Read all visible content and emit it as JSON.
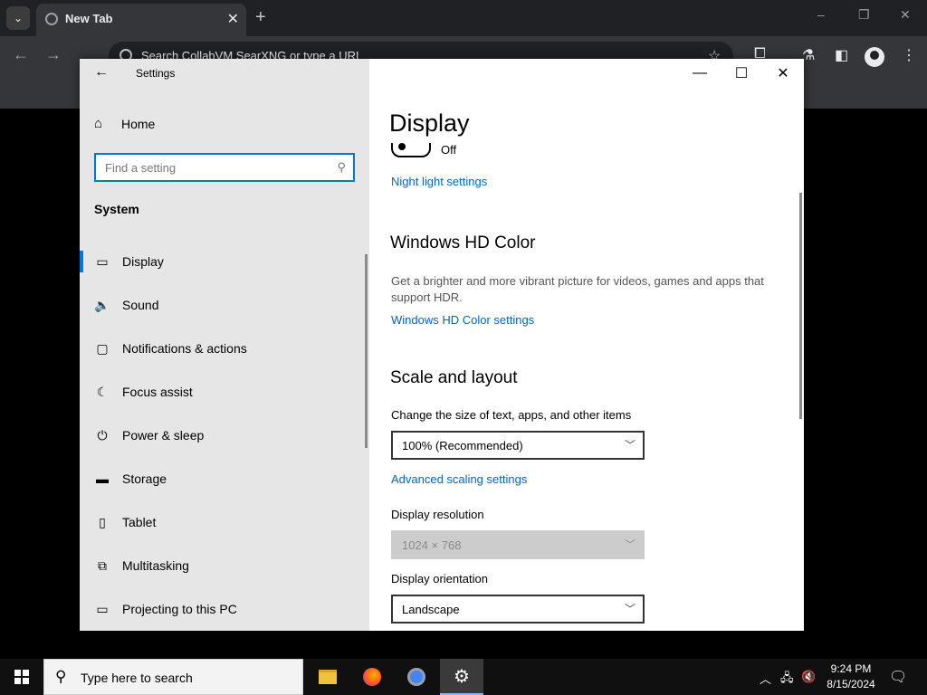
{
  "browser": {
    "tab_list_icon": "chevron-down-icon",
    "tab_title": "New Tab",
    "tab_close": "✕",
    "new_tab": "+",
    "minimize": "–",
    "restore": "❐",
    "close": "✕",
    "back": "←",
    "forward": "→",
    "omnibox_placeholder": "Search CollabVM SearXNG or type a URL",
    "icons": [
      "star-icon",
      "extensions-icon",
      "labs-icon",
      "sidebar-icon",
      "profile-icon",
      "menu-icon"
    ]
  },
  "settings": {
    "app_title": "Settings",
    "back_glyph": "←",
    "home_label": "Home",
    "search_placeholder": "Find a setting",
    "section_title": "System",
    "nav_items": [
      {
        "label": "Display",
        "icon": "monitor-icon",
        "glyph": "▭"
      },
      {
        "label": "Sound",
        "icon": "speaker-icon",
        "glyph": "🔈"
      },
      {
        "label": "Notifications & actions",
        "icon": "notification-icon",
        "glyph": "▢"
      },
      {
        "label": "Focus assist",
        "icon": "moon-icon",
        "glyph": "☾"
      },
      {
        "label": "Power & sleep",
        "icon": "power-icon",
        "glyph": "⏻"
      },
      {
        "label": "Storage",
        "icon": "storage-icon",
        "glyph": "▬"
      },
      {
        "label": "Tablet",
        "icon": "tablet-icon",
        "glyph": "▯"
      },
      {
        "label": "Multitasking",
        "icon": "multitasking-icon",
        "glyph": "⧉"
      },
      {
        "label": "Projecting to this PC",
        "icon": "project-icon",
        "glyph": "▭"
      }
    ],
    "active_item": "Display",
    "window_controls": {
      "minimize": "—",
      "maximize": "☐",
      "close": "✕"
    },
    "accent_color": "#0078d7",
    "link_color": "#0067c0"
  },
  "display": {
    "page_title": "Display",
    "night_light_state": "Off",
    "night_light_link": "Night light settings",
    "hd_color_heading": "Windows HD Color",
    "hd_color_description": "Get a brighter and more vibrant picture for videos, games and apps that support HDR.",
    "hd_color_link": "Windows HD Color settings",
    "scale_heading": "Scale and layout",
    "scale_label": "Change the size of text, apps, and other items",
    "scale_value": "100% (Recommended)",
    "advanced_scaling_link": "Advanced scaling settings",
    "resolution_label": "Display resolution",
    "resolution_value": "1024 × 768",
    "orientation_label": "Display orientation",
    "orientation_value": "Landscape"
  },
  "taskbar": {
    "search_placeholder": "Type here to search",
    "apps": [
      "file-explorer-icon",
      "firefox-icon",
      "chrome-icon",
      "settings-icon"
    ],
    "time": "9:24 PM",
    "date": "8/15/2024"
  }
}
